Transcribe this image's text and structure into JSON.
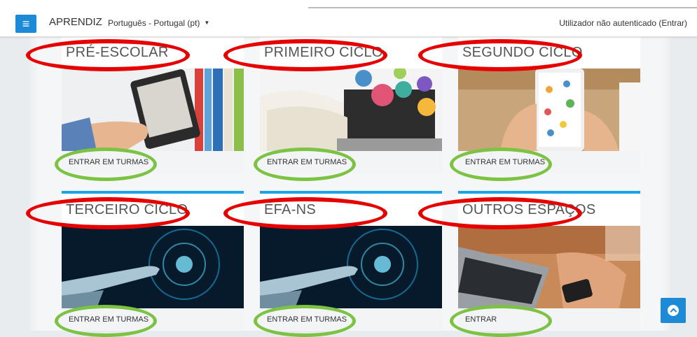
{
  "header": {
    "brand": "APRENDIZ",
    "language": "Português - Portugal (pt)",
    "login_status": "Utilizador não autenticado (Entrar)",
    "menu_icon": "hamburger-menu-icon"
  },
  "cards": [
    {
      "title": "PRÉ-ESCOLAR",
      "button": "ENTRAR EM TURMAS",
      "image": "hand-holding-ereader-image"
    },
    {
      "title": "PRIMEIRO CICLO",
      "button": "ENTRAR EM TURMAS",
      "image": "book-on-laptop-science-icons-image"
    },
    {
      "title": "SEGUNDO CICLO",
      "button": "ENTRAR EM TURMAS",
      "image": "tablet-network-icons-image"
    },
    {
      "title": "TERCEIRO CICLO",
      "button": "ENTRAR EM TURMAS",
      "image": "finger-touching-digital-screen-image"
    },
    {
      "title": "EFA-NS",
      "button": "ENTRAR EM TURMAS",
      "image": "finger-touching-digital-screen-image"
    },
    {
      "title": "OUTROS ESPAÇOS",
      "button": "ENTRAR",
      "image": "hands-on-laptop-and-phone-image"
    }
  ],
  "scroll_top_icon": "chevron-up-icon",
  "colors": {
    "accent": "#1ea2e8",
    "menu_button": "#1c8ad6",
    "highlight_red": "#e60000",
    "highlight_green": "#7cc243"
  }
}
